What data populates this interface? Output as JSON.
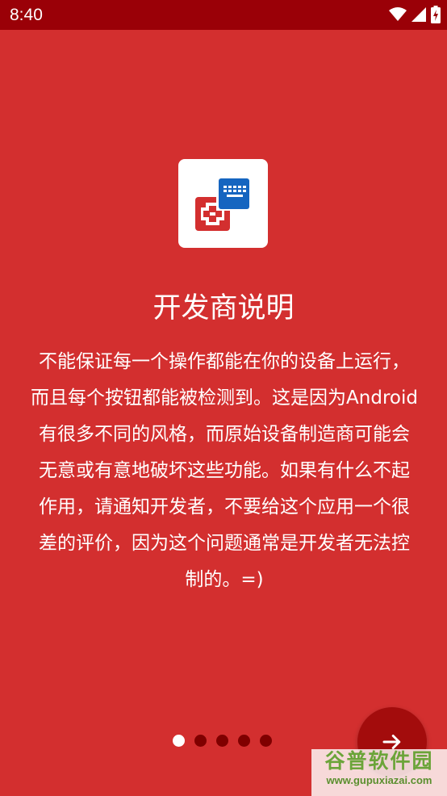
{
  "status_bar": {
    "time": "8:40",
    "icons": [
      "wifi-icon",
      "signal-icon",
      "battery-charging-icon"
    ]
  },
  "onboarding": {
    "title": "开发商说明",
    "description_lines": [
      "不能保证每一个操作都能在你的设备上运行，",
      "而且每个按钮都能被检测到。这是因为Android",
      "有很多不同的风格，而原始设备制造商可能会",
      "无意或有意地破坏这些功能。如果有什么不起",
      "作用，请通知开发者，不要给这个应用一个很",
      "差的评价，因为这个问题通常是开发者无法控",
      "制的。=)"
    ],
    "page_count": 5,
    "current_page": 1
  },
  "next_button": {
    "icon": "arrow-right-icon"
  },
  "watermark": {
    "title": "谷普软件园",
    "url": "www.gupuxiazai.com"
  },
  "colors": {
    "background": "#D32F2F",
    "status_bar": "#9A0007",
    "icon_red": "#D32F2F",
    "icon_blue": "#1565C0",
    "dot_inactive": "#7F0000",
    "fab": "#A30C0C"
  }
}
